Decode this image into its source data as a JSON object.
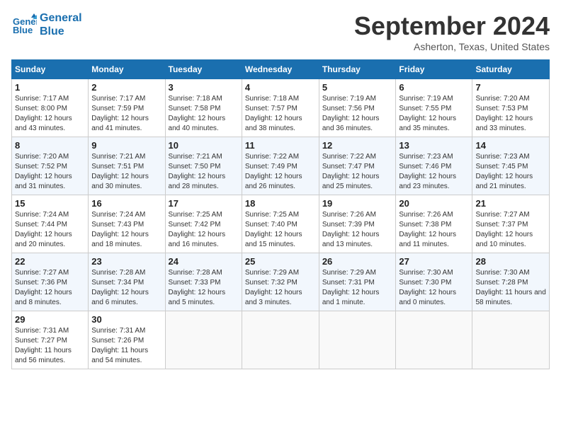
{
  "header": {
    "logo_line1": "General",
    "logo_line2": "Blue",
    "month_year": "September 2024",
    "location": "Asherton, Texas, United States"
  },
  "columns": [
    "Sunday",
    "Monday",
    "Tuesday",
    "Wednesday",
    "Thursday",
    "Friday",
    "Saturday"
  ],
  "weeks": [
    [
      {
        "day": "1",
        "sunrise": "7:17 AM",
        "sunset": "8:00 PM",
        "daylight": "12 hours and 43 minutes"
      },
      {
        "day": "2",
        "sunrise": "7:17 AM",
        "sunset": "7:59 PM",
        "daylight": "12 hours and 41 minutes"
      },
      {
        "day": "3",
        "sunrise": "7:18 AM",
        "sunset": "7:58 PM",
        "daylight": "12 hours and 40 minutes"
      },
      {
        "day": "4",
        "sunrise": "7:18 AM",
        "sunset": "7:57 PM",
        "daylight": "12 hours and 38 minutes"
      },
      {
        "day": "5",
        "sunrise": "7:19 AM",
        "sunset": "7:56 PM",
        "daylight": "12 hours and 36 minutes"
      },
      {
        "day": "6",
        "sunrise": "7:19 AM",
        "sunset": "7:55 PM",
        "daylight": "12 hours and 35 minutes"
      },
      {
        "day": "7",
        "sunrise": "7:20 AM",
        "sunset": "7:53 PM",
        "daylight": "12 hours and 33 minutes"
      }
    ],
    [
      {
        "day": "8",
        "sunrise": "7:20 AM",
        "sunset": "7:52 PM",
        "daylight": "12 hours and 31 minutes"
      },
      {
        "day": "9",
        "sunrise": "7:21 AM",
        "sunset": "7:51 PM",
        "daylight": "12 hours and 30 minutes"
      },
      {
        "day": "10",
        "sunrise": "7:21 AM",
        "sunset": "7:50 PM",
        "daylight": "12 hours and 28 minutes"
      },
      {
        "day": "11",
        "sunrise": "7:22 AM",
        "sunset": "7:49 PM",
        "daylight": "12 hours and 26 minutes"
      },
      {
        "day": "12",
        "sunrise": "7:22 AM",
        "sunset": "7:47 PM",
        "daylight": "12 hours and 25 minutes"
      },
      {
        "day": "13",
        "sunrise": "7:23 AM",
        "sunset": "7:46 PM",
        "daylight": "12 hours and 23 minutes"
      },
      {
        "day": "14",
        "sunrise": "7:23 AM",
        "sunset": "7:45 PM",
        "daylight": "12 hours and 21 minutes"
      }
    ],
    [
      {
        "day": "15",
        "sunrise": "7:24 AM",
        "sunset": "7:44 PM",
        "daylight": "12 hours and 20 minutes"
      },
      {
        "day": "16",
        "sunrise": "7:24 AM",
        "sunset": "7:43 PM",
        "daylight": "12 hours and 18 minutes"
      },
      {
        "day": "17",
        "sunrise": "7:25 AM",
        "sunset": "7:42 PM",
        "daylight": "12 hours and 16 minutes"
      },
      {
        "day": "18",
        "sunrise": "7:25 AM",
        "sunset": "7:40 PM",
        "daylight": "12 hours and 15 minutes"
      },
      {
        "day": "19",
        "sunrise": "7:26 AM",
        "sunset": "7:39 PM",
        "daylight": "12 hours and 13 minutes"
      },
      {
        "day": "20",
        "sunrise": "7:26 AM",
        "sunset": "7:38 PM",
        "daylight": "12 hours and 11 minutes"
      },
      {
        "day": "21",
        "sunrise": "7:27 AM",
        "sunset": "7:37 PM",
        "daylight": "12 hours and 10 minutes"
      }
    ],
    [
      {
        "day": "22",
        "sunrise": "7:27 AM",
        "sunset": "7:36 PM",
        "daylight": "12 hours and 8 minutes"
      },
      {
        "day": "23",
        "sunrise": "7:28 AM",
        "sunset": "7:34 PM",
        "daylight": "12 hours and 6 minutes"
      },
      {
        "day": "24",
        "sunrise": "7:28 AM",
        "sunset": "7:33 PM",
        "daylight": "12 hours and 5 minutes"
      },
      {
        "day": "25",
        "sunrise": "7:29 AM",
        "sunset": "7:32 PM",
        "daylight": "12 hours and 3 minutes"
      },
      {
        "day": "26",
        "sunrise": "7:29 AM",
        "sunset": "7:31 PM",
        "daylight": "12 hours and 1 minute"
      },
      {
        "day": "27",
        "sunrise": "7:30 AM",
        "sunset": "7:30 PM",
        "daylight": "12 hours and 0 minutes"
      },
      {
        "day": "28",
        "sunrise": "7:30 AM",
        "sunset": "7:28 PM",
        "daylight": "11 hours and 58 minutes"
      }
    ],
    [
      {
        "day": "29",
        "sunrise": "7:31 AM",
        "sunset": "7:27 PM",
        "daylight": "11 hours and 56 minutes"
      },
      {
        "day": "30",
        "sunrise": "7:31 AM",
        "sunset": "7:26 PM",
        "daylight": "11 hours and 54 minutes"
      },
      null,
      null,
      null,
      null,
      null
    ]
  ]
}
